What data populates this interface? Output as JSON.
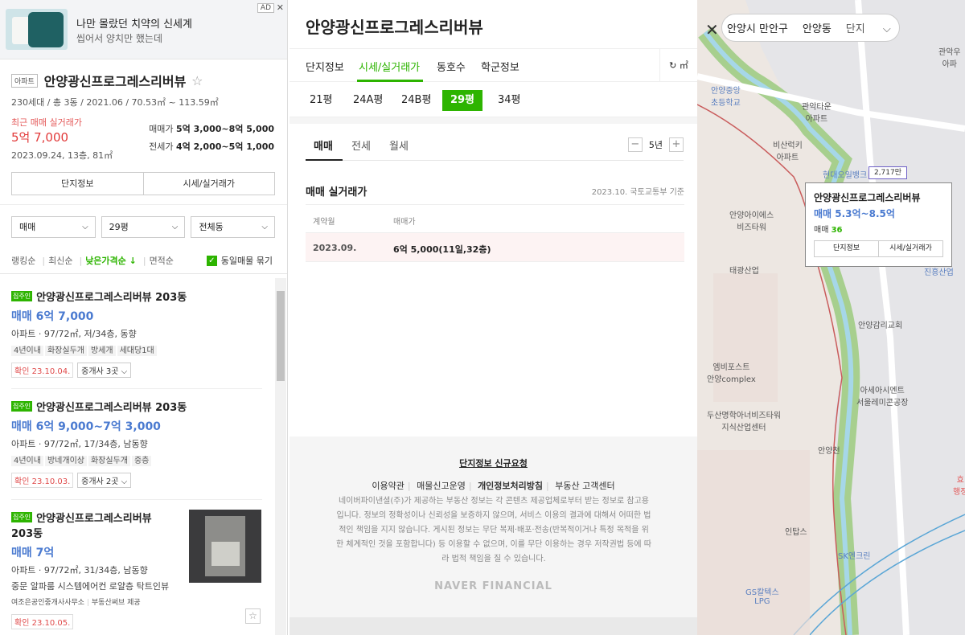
{
  "ad": {
    "title": "나만 몰랐던 치약의 신세계",
    "subtitle": "씹어서 양치만 했는데",
    "badge": "AD",
    "close": "✕"
  },
  "complex": {
    "tag": "아파트",
    "name": "안양광신프로그레스리버뷰",
    "info": "230세대 / 총 3동 / 2021.06 / 70.53㎡ ~ 113.59㎡",
    "recent_label": "최근 매매 실거래가",
    "recent_price": "5억 7,000",
    "recent_detail": "2023.09.24, 13층, 81㎡",
    "sale_label": "매매가",
    "sale_range": "5억 3,000~8억 5,000",
    "jeonse_label": "전세가",
    "jeonse_range": "4억 2,000~5억 1,000",
    "btn_info": "단지정보",
    "btn_price": "시세/실거래가"
  },
  "filters": {
    "type": "매매",
    "area": "29평",
    "dong": "전체동"
  },
  "sorts": {
    "ranking": "랭킹순",
    "latest": "최신순",
    "low_price": "낮은가격순 ↓",
    "area": "면적순",
    "group": "동일매물 묶기"
  },
  "listings": [
    {
      "badge": "집주인",
      "name": "안양광신프로그레스리버뷰 203동",
      "price": "매매 6억 7,000",
      "spec": "아파트 · 97/72㎡, 저/34층, 동향",
      "tags": [
        "4년이내",
        "화장실두개",
        "방세개",
        "세대당1대"
      ],
      "confirm": "확인 23.10.04.",
      "broker": "중개사 3곳"
    },
    {
      "badge": "집주인",
      "name": "안양광신프로그레스리버뷰 203동",
      "price": "매매 6억 9,000~7억 3,000",
      "spec": "아파트 · 97/72㎡, 17/34층, 남동향",
      "tags": [
        "4년이내",
        "방네개이상",
        "화장실두개",
        "중층"
      ],
      "confirm": "확인 23.10.03.",
      "broker": "중개사 2곳"
    },
    {
      "badge": "집주인",
      "name_line1": "안양광신프로그레스리버뷰",
      "name_line2": "203동",
      "price": "매매 7억",
      "spec": "아파트 · 97/72㎡, 31/34층, 남동향",
      "desc": "중문 알파룸 시스템에어컨 로얄층 탁트인뷰",
      "agent": "여조은공인중개사사무소",
      "source": "부동산써브 제공",
      "confirm": "확인 23.10.05."
    }
  ],
  "detail": {
    "title": "안양광신프로그레스리버뷰",
    "tabs": [
      "단지정보",
      "시세/실거래가",
      "동호수",
      "학군정보"
    ],
    "refresh": "↻ ㎡",
    "pyeong": [
      "21평",
      "24A평",
      "24B평",
      "29평",
      "34평"
    ],
    "deal_tabs": [
      "매매",
      "전세",
      "월세"
    ],
    "period": "5년",
    "minus": "−",
    "plus": "+",
    "section_title": "매매 실거래가",
    "source": "2023.10. 국토교통부 기준",
    "col_date": "계약월",
    "col_price": "매매가",
    "row_date": "2023.09.",
    "row_price": "6억 5,000(11일,32층)"
  },
  "footer": {
    "request": "단지정보 신규요청",
    "links": [
      "이용약관",
      "매물신고운영",
      "개인정보처리방침",
      "부동산 고객센터"
    ],
    "text": "네이버파이낸셜(주)가 제공하는 부동산 정보는 각 콘텐츠 제공업체로부터 받는 정보로 참고용입니다. 정보의 정확성이나 신뢰성을 보증하지 않으며, 서비스 이용의 결과에 대해서 어떠한 법적인 책임을 지지 않습니다. 게시된 정보는 무단 복제·배포·전송(반복적이거나 특정 목적을 위한 체계적인 것을 포함합니다) 등 이용할 수 없으며, 이를 무단 이용하는 경우 저작권법 등에 따라 법적 책임을 질 수 있습니다.",
    "logo": "NAVER FINANCIAL"
  },
  "map": {
    "crumbs": [
      "안양시 만안구",
      "안양동",
      "단지"
    ],
    "close": "✕",
    "labels": {
      "school": "안양중앙\n초등학교",
      "gwanak": "관악타운\n아파트",
      "gwanak2": "관악우\n아파",
      "bisan": "비산럭키\n아파트",
      "hyundai": "현대오일뱅크",
      "ipark": "안양아이에스\n비즈타워",
      "taeyoung": "태광산업",
      "church": "안양감리교회",
      "emb": "엠비포스트\n안양complex",
      "asia": "아세아시멘트\n서울레미콘공장",
      "doosan": "두산명학아너비즈타워\n지식산업센터",
      "ancheon": "안양천",
      "intop": "인탑스",
      "sk": "SK엔크린",
      "gs": "GS칼텍스\nLPG",
      "jinheung": "진흥산업",
      "hyo": "효\n행정"
    },
    "price_tag": "2,717만",
    "card": {
      "name": "안양광신프로그레스리버뷰",
      "price": "매매 5.3억~8.5억",
      "count_label": "매매",
      "count": "36",
      "btn_info": "단지정보",
      "btn_price": "시세/실거래가"
    }
  },
  "colors": {
    "accent": "#2db400",
    "price_blue": "#4a7ad0",
    "red": "#e23a3a"
  }
}
